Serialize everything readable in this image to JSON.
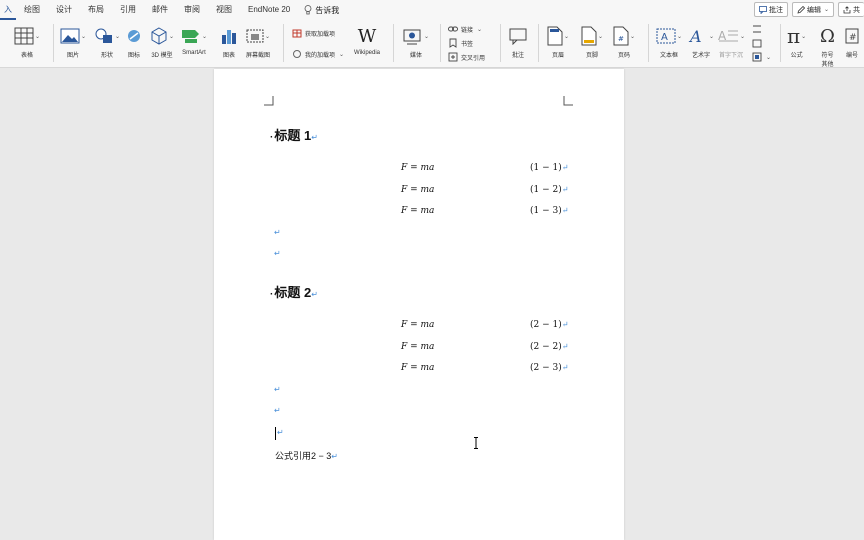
{
  "menu": {
    "tabs": [
      "入",
      "绘图",
      "设计",
      "布局",
      "引用",
      "邮件",
      "审阅",
      "视图",
      "EndNote 20"
    ],
    "tell_me": "告诉我",
    "comment_button": "批注",
    "edit_button": "编辑",
    "share_partial": "共"
  },
  "ribbon": {
    "table": "表格",
    "picture": "图片",
    "shapes": "形状",
    "icons": "图标",
    "models_3d": "3D 模型",
    "smartart": "SmartArt",
    "chart": "图表",
    "screenshot": "屏幕截图",
    "get_addins": "获取加载项",
    "my_addins": "我的加载项",
    "wikipedia": "Wikipedia",
    "online_video": "媒体",
    "link": "链接",
    "bookmark": "书签",
    "cross_ref": "交叉引用",
    "comment": "批注",
    "header": "页眉",
    "footer": "页脚",
    "page_number": "页码",
    "text_box": "文本框",
    "wordart": "艺术字",
    "dropcap": "首字下沉",
    "equation": "公式",
    "symbol": "符号",
    "symbol_sub": "其他",
    "number": "编号"
  },
  "document": {
    "heading1": "标题 1",
    "heading2": "标题 2",
    "equations1": [
      {
        "formula": "F = ma",
        "number": "(1 − 1)"
      },
      {
        "formula": "F = ma",
        "number": "(1 − 2)"
      },
      {
        "formula": "F = ma",
        "number": "(1 − 3)"
      }
    ],
    "equations2": [
      {
        "formula": "F = ma",
        "number": "(2 − 1)"
      },
      {
        "formula": "F = ma",
        "number": "(2 − 2)"
      },
      {
        "formula": "F = ma",
        "number": "(2 − 3)"
      }
    ],
    "reference_text": "公式引用2 − 3",
    "para_mark": "↵"
  }
}
